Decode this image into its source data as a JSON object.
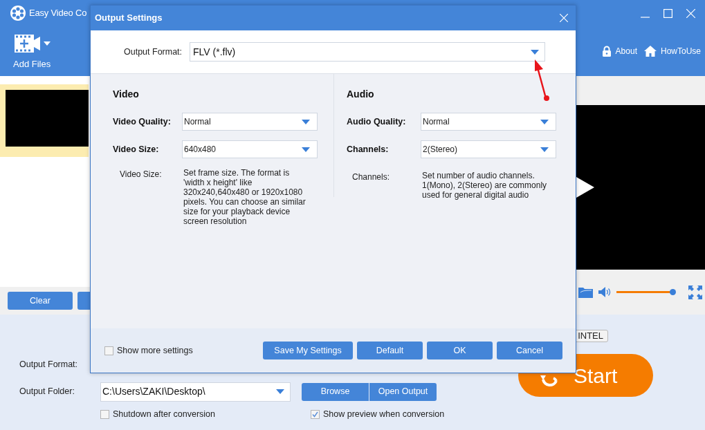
{
  "app": {
    "title": "Easy Video Co",
    "toolbar": {
      "add_files": "Add Files",
      "links": [
        {
          "kind": "lock",
          "label": "About"
        },
        {
          "kind": "home",
          "label": "HowToUse"
        }
      ]
    },
    "list_buttons": [
      "Clear"
    ],
    "player": {
      "volume": {
        "level": 1
      }
    },
    "bottom": {
      "gpu_tag": "INTEL",
      "output_format_label": "Output Format:",
      "output_folder_label": "Output Folder:",
      "output_folder": "C:\\Users\\ZAKI\\Desktop\\",
      "browse": "Browse",
      "open_output": "Open Output",
      "start": "Start",
      "options": [
        {
          "label": "Shutdown after conversion",
          "checked": false
        },
        {
          "label": "Show preview when conversion",
          "checked": true
        }
      ]
    }
  },
  "dialog": {
    "title": "Output Settings",
    "output_format_label": "Output Format:",
    "output_format": "FLV (*.flv)",
    "sections": [
      {
        "heading": "Video",
        "fields": [
          {
            "label": "Video Quality:",
            "value": "Normal"
          },
          {
            "label": "Video Size:",
            "value": "640x480"
          }
        ],
        "help_label": "Video Size:",
        "help_text": "Set frame size. The format is 'width x height' like 320x240,640x480 or 1920x1080 pixels. You can choose an similar size for your playback device screen resolution"
      },
      {
        "heading": "Audio",
        "fields": [
          {
            "label": "Audio Quality:",
            "value": "Normal"
          },
          {
            "label": "Channels:",
            "value": "2(Stereo)"
          }
        ],
        "help_label": "Channels:",
        "help_text": "Set number of audio channels. 1(Mono), 2(Stereo) are commonly used for general digital audio"
      }
    ],
    "show_more": {
      "label": "Show more settings",
      "checked": false
    },
    "buttons": [
      "Save My Settings",
      "Default",
      "OK",
      "Cancel"
    ]
  }
}
